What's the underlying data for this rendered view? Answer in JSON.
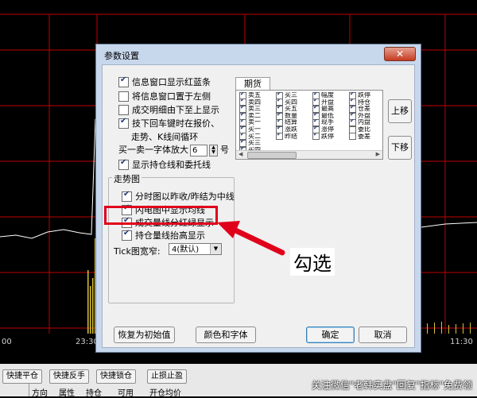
{
  "chart": {
    "time_labels": [
      "00",
      "23:30",
      "11:30"
    ],
    "grid_color": "#c00000",
    "price_line_color": "#ffffff",
    "volume_bar_color": "#d8c13a"
  },
  "dialog": {
    "title": "参数设置",
    "close_symbol": "✕",
    "left_options": [
      {
        "label": "信息窗口显示红蓝条",
        "checked": true
      },
      {
        "label": "将信息窗口置于左侧",
        "checked": false
      },
      {
        "label": "成交明细由下至上显示",
        "checked": false
      },
      {
        "label": "技下回车键时在报价、",
        "checked": true
      }
    ],
    "enter_cycle_text": "走势、K线间循环",
    "font_zoom": {
      "prefix": "买一卖一字体放大",
      "value": "6",
      "suffix": "号"
    },
    "show_position_option": {
      "label": "显示持仓线和委托线",
      "checked": true
    },
    "trend_group": {
      "title": "走势图",
      "options": [
        {
          "label": "分时图以昨收/昨结为中线",
          "checked": true
        },
        {
          "label": "闪电图中显示均线",
          "checked": true
        },
        {
          "label": "成交量线分红绿显示",
          "checked": true
        },
        {
          "label": "持仓量线抬高显示",
          "checked": true
        }
      ],
      "tick_label": "Tick图宽窄:",
      "tick_value": "4(默认)"
    },
    "futures_tab": "期货",
    "futures_columns": [
      [
        "卖五",
        "卖四",
        "卖三",
        "卖二",
        "卖一",
        "买一",
        "买二",
        "买三",
        "买四"
      ],
      [
        "买三",
        "买四",
        "买五",
        "数量",
        "结算",
        "涨跌",
        "昨结"
      ],
      [
        "幅度",
        "开盘",
        "最高",
        "最低",
        "现手",
        "涨停",
        "跌停"
      ],
      [
        "跌停",
        "持仓",
        "仓差",
        "外盘",
        "内盘",
        "委比",
        "委差"
      ]
    ],
    "futures_checks": [
      [
        true,
        true,
        true,
        true,
        true,
        true,
        true,
        true,
        true
      ],
      [
        true,
        true,
        true,
        true,
        true,
        true,
        true
      ],
      [
        true,
        true,
        true,
        true,
        true,
        true,
        true
      ],
      [
        true,
        true,
        true,
        true,
        true,
        false,
        false
      ]
    ],
    "move_up": "上移",
    "move_down": "下移",
    "buttons": {
      "reset": "恢复为初始值",
      "colors_fonts": "颜色和字体",
      "ok": "确定",
      "cancel": "取消"
    }
  },
  "bottom_bar": {
    "buttons": [
      "快捷平仓",
      "快捷反手",
      "快捷锁仓",
      "止损止盈"
    ],
    "columns": [
      "方向",
      "属性",
      "持仓",
      "可用",
      "开仓均价"
    ]
  },
  "annotation": {
    "callout": "勾选"
  },
  "watermark": "关注微信\"老韩实盘\"回复\"指标\"免费领"
}
